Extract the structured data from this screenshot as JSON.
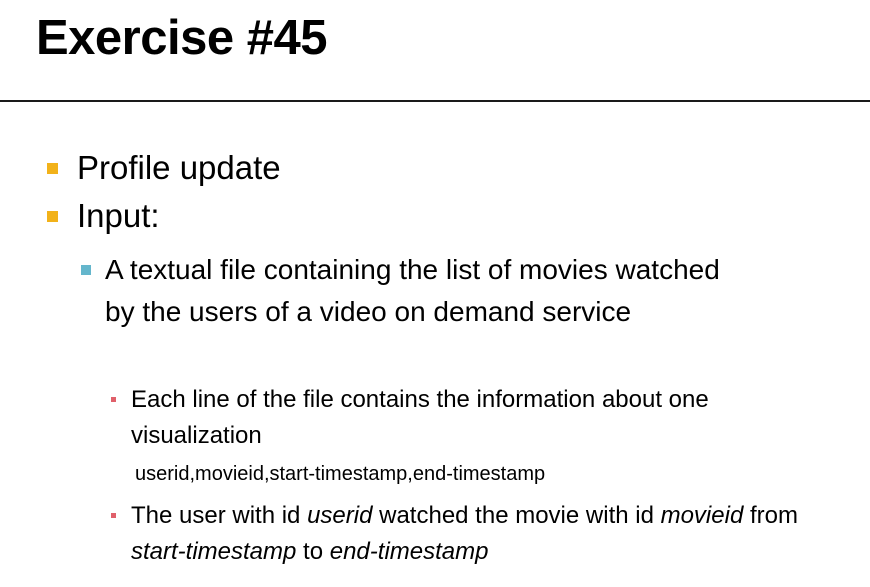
{
  "slide": {
    "title": "Exercise #45",
    "bullets_level1": [
      "Profile update",
      "Input:"
    ],
    "bullet_level2": "A textual file containing the list of movies watched by the users of a video on demand service",
    "sub_bullet_1": "Each line of the file contains the information about one visualization",
    "format_line": "userid,movieid,start-timestamp,end-timestamp",
    "sub_bullet_2": {
      "t1": "The user with id ",
      "userid": "userid",
      "t2": " watched the movie with id ",
      "movieid": "movieid",
      "t3": " from ",
      "start": "start-timestamp",
      "t4": " to ",
      "end": "end-timestamp"
    }
  },
  "colors": {
    "level1_marker": "#f2b21a",
    "level2_marker": "#64b6cc",
    "level3_marker": "#e0606a"
  }
}
